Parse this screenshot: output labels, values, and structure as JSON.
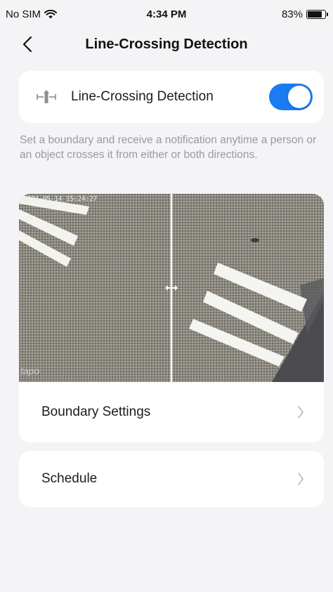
{
  "status_bar": {
    "carrier": "No SIM",
    "time": "4:34 PM",
    "battery": "83%",
    "battery_level": 0.83
  },
  "nav": {
    "title": "Line-Crossing Detection",
    "back_icon": "chevron-left-icon"
  },
  "detection_toggle": {
    "label": "Line-Crossing Detection",
    "enabled": true,
    "icon": "line-crossing-icon",
    "on_color": "#1a7cf2"
  },
  "description": "Set a boundary and receive a notification anytime a person or an object crosses it from either or both directions.",
  "preview": {
    "timestamp": "2024-05-14 15:24:27",
    "watermark": "tapo",
    "direction_icon": "bidirectional-arrow-icon"
  },
  "menu": [
    {
      "label": "Boundary Settings",
      "icon": "chevron-right-icon"
    },
    {
      "label": "Schedule",
      "icon": "chevron-right-icon"
    }
  ]
}
